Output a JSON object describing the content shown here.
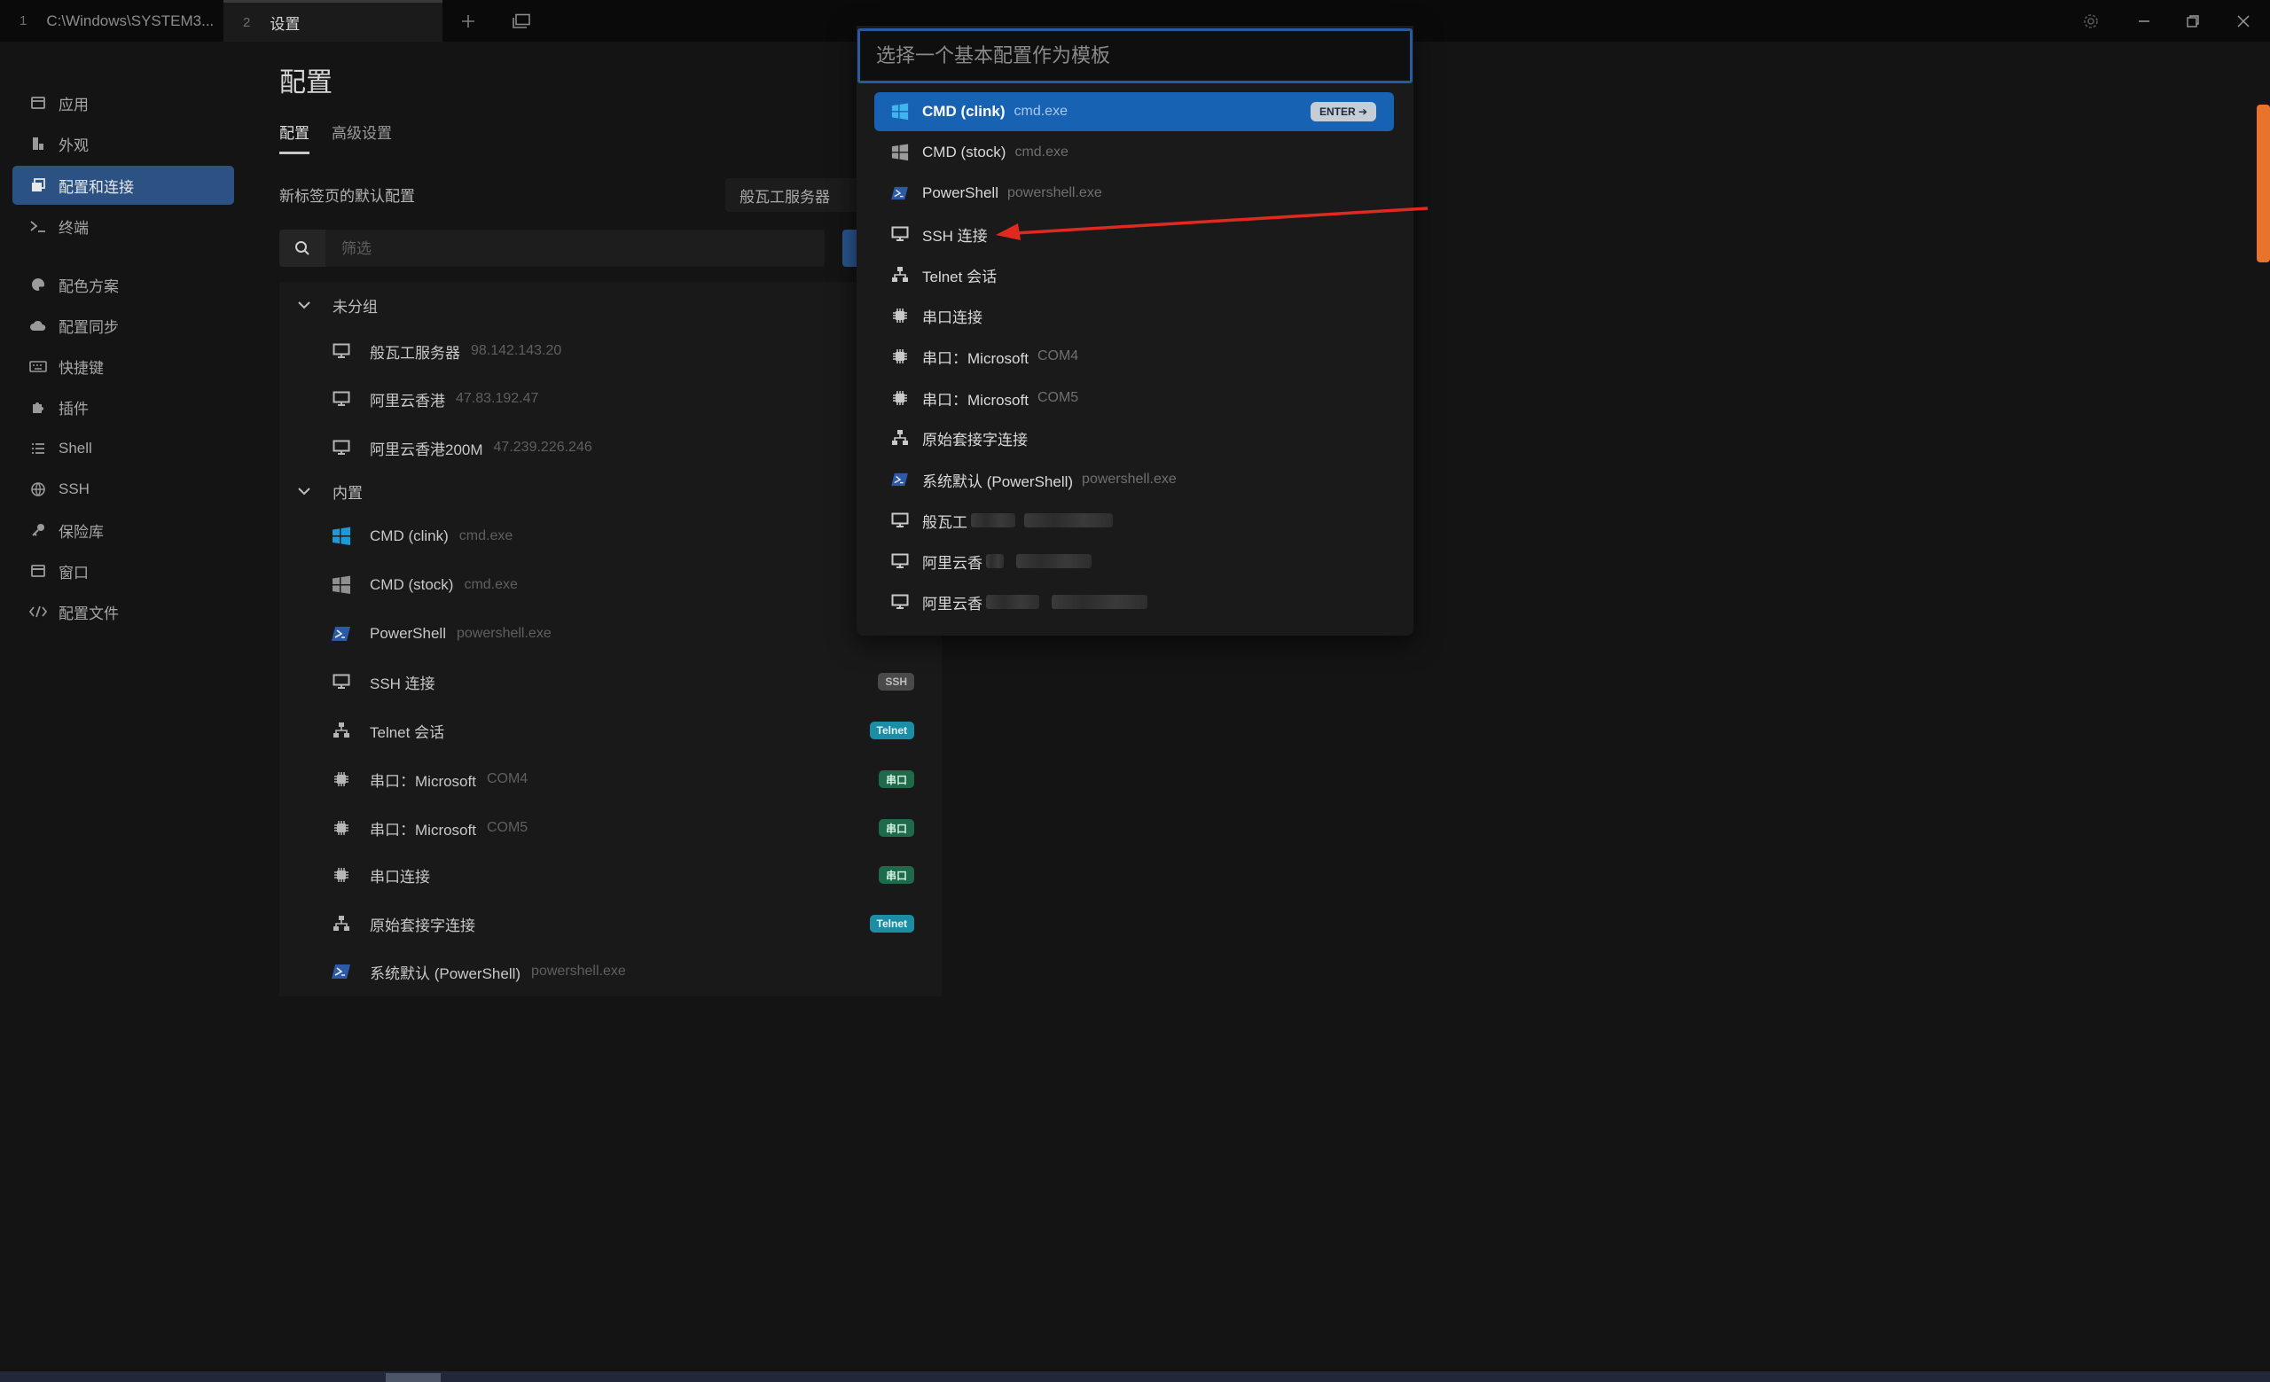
{
  "titlebar": {
    "tabs": [
      {
        "num": "1",
        "label": "C:\\Windows\\SYSTEM3..."
      },
      {
        "num": "2",
        "label": "设置"
      }
    ]
  },
  "sidebar": {
    "items": [
      {
        "label": "应用",
        "icon": "app-window-icon"
      },
      {
        "label": "外观",
        "icon": "paint-icon"
      },
      {
        "label": "配置和连接",
        "icon": "profiles-icon",
        "active": true
      },
      {
        "label": "终端",
        "icon": "terminal-icon"
      },
      {
        "label": "配色方案",
        "icon": "palette-icon"
      },
      {
        "label": "配置同步",
        "icon": "cloud-icon"
      },
      {
        "label": "快捷键",
        "icon": "keyboard-icon"
      },
      {
        "label": "插件",
        "icon": "puzzle-icon"
      },
      {
        "label": "Shell",
        "icon": "list-icon"
      },
      {
        "label": "SSH",
        "icon": "globe-icon"
      },
      {
        "label": "保险库",
        "icon": "key-icon"
      },
      {
        "label": "窗口",
        "icon": "window-icon"
      },
      {
        "label": "配置文件",
        "icon": "code-icon"
      }
    ]
  },
  "main": {
    "title": "配置",
    "subtabs": [
      "配置",
      "高级设置"
    ],
    "default_label": "新标签页的默认配置",
    "default_value": "般瓦工服务器",
    "filter_placeholder": "筛选",
    "groups": [
      {
        "name": "未分组",
        "rows": [
          {
            "label": "般瓦工服务器",
            "sub": "98.142.143.20",
            "icon": "monitor-icon"
          },
          {
            "label": "阿里云香港",
            "sub": "47.83.192.47",
            "icon": "monitor-icon"
          },
          {
            "label": "阿里云香港200M",
            "sub": "47.239.226.246",
            "icon": "monitor-icon"
          }
        ]
      },
      {
        "name": "内置",
        "rows": [
          {
            "label": "CMD (clink)",
            "sub": "cmd.exe",
            "icon": "windows-icon",
            "badge": ""
          },
          {
            "label": "CMD (stock)",
            "sub": "cmd.exe",
            "icon": "windows-icon",
            "badge": ""
          },
          {
            "label": "PowerShell",
            "sub": "powershell.exe",
            "icon": "powershell-icon",
            "badge": ""
          },
          {
            "label": "SSH 连接",
            "sub": "",
            "icon": "monitor-icon",
            "badge": "SSH"
          },
          {
            "label": "Telnet 会话",
            "sub": "",
            "icon": "network-icon",
            "badge": "Telnet"
          },
          {
            "label": "串口：Microsoft",
            "sub": "COM4",
            "icon": "chip-icon",
            "badge": "串口"
          },
          {
            "label": "串口：Microsoft",
            "sub": "COM5",
            "icon": "chip-icon",
            "badge": "串口"
          },
          {
            "label": "串口连接",
            "sub": "",
            "icon": "chip-icon",
            "badge": "串口"
          },
          {
            "label": "原始套接字连接",
            "sub": "",
            "icon": "network-icon",
            "badge": "Telnet"
          },
          {
            "label": "系统默认 (PowerShell)",
            "sub": "powershell.exe",
            "icon": "powershell-icon",
            "badge": ""
          }
        ]
      }
    ]
  },
  "modal": {
    "placeholder": "选择一个基本配置作为模板",
    "enter_label": "ENTER ➔",
    "items": [
      {
        "label": "CMD (clink)",
        "sub": "cmd.exe",
        "icon": "windows-icon",
        "active": true
      },
      {
        "label": "CMD (stock)",
        "sub": "cmd.exe",
        "icon": "windows-icon"
      },
      {
        "label": "PowerShell",
        "sub": "powershell.exe",
        "icon": "powershell-icon"
      },
      {
        "label": "SSH 连接",
        "sub": "",
        "icon": "monitor-icon"
      },
      {
        "label": "Telnet 会话",
        "sub": "",
        "icon": "network-icon"
      },
      {
        "label": "串口连接",
        "sub": "",
        "icon": "chip-icon"
      },
      {
        "label": "串口：Microsoft",
        "sub": "COM4",
        "icon": "chip-icon"
      },
      {
        "label": "串口：Microsoft",
        "sub": "COM5",
        "icon": "chip-icon"
      },
      {
        "label": "原始套接字连接",
        "sub": "",
        "icon": "network-icon"
      },
      {
        "label": "系统默认 (PowerShell)",
        "sub": "powershell.exe",
        "icon": "powershell-icon"
      },
      {
        "label": "般瓦工",
        "sub": "",
        "icon": "monitor-icon",
        "redacted": true
      },
      {
        "label": "阿里云香",
        "sub": "",
        "icon": "monitor-icon",
        "redacted": true
      },
      {
        "label": "阿里云香",
        "sub": "",
        "icon": "monitor-icon",
        "redacted": true
      }
    ]
  },
  "colors": {
    "accent": "#1862b4",
    "sidebar_active": "#2b5283",
    "annotation_arrow": "#e0291f",
    "badge_ssh": "#4a4a4a",
    "badge_telnet": "#1b8ea6",
    "badge_serial": "#1f6a4a"
  }
}
